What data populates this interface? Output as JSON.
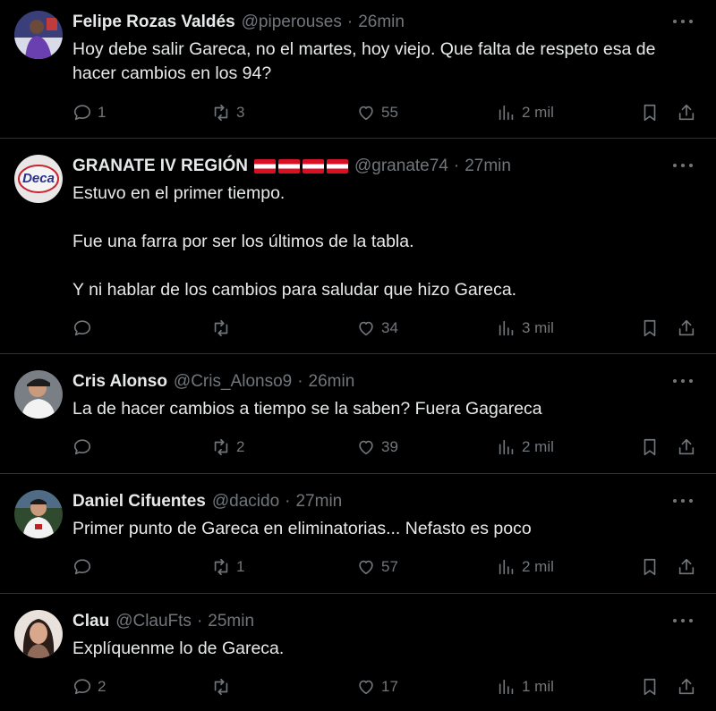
{
  "tweets": [
    {
      "name": "Felipe Rozas Valdés",
      "handle": "@piperouses",
      "time": "26min",
      "text": "Hoy debe salir Gareca, no el martes, hoy viejo. Que falta de respeto esa de hacer cambios en los 94?",
      "replies": "1",
      "retweets": "3",
      "likes": "55",
      "views": "2 mil",
      "avatar_icon": "user-avatar-player"
    },
    {
      "name": "GRANATE IV REGIÓN",
      "handle": "@granate74",
      "time": "27min",
      "text": "Estuvo en el primer tiempo.\n\nFue una farra por ser los últimos de la tabla.\n\nY ni hablar de los cambios para saludar que hizo Gareca.",
      "replies": "",
      "retweets": "",
      "likes": "34",
      "views": "3 mil",
      "avatar_icon": "user-avatar-logo",
      "avatar_text": "Deca",
      "flags": 4
    },
    {
      "name": "Cris Alonso",
      "handle": "@Cris_Alonso9",
      "time": "26min",
      "text": "La de hacer cambios a tiempo se la saben? Fuera Gagareca",
      "replies": "",
      "retweets": "2",
      "likes": "39",
      "views": "2 mil",
      "avatar_icon": "user-avatar-person"
    },
    {
      "name": "Daniel Cifuentes",
      "handle": "@dacido",
      "time": "27min",
      "text": "Primer punto de Gareca en eliminatorias... Nefasto es poco",
      "replies": "",
      "retweets": "1",
      "likes": "57",
      "views": "2 mil",
      "avatar_icon": "user-avatar-player"
    },
    {
      "name": "Clau",
      "handle": "@ClauFts",
      "time": "25min",
      "text": "Explíquenme lo de Gareca.",
      "replies": "2",
      "retweets": "",
      "likes": "17",
      "views": "1 mil",
      "avatar_icon": "user-avatar-woman"
    }
  ],
  "colors": {
    "background": "#000000",
    "text": "#e7e9ea",
    "muted": "#71767b",
    "divider": "#2f3336"
  }
}
